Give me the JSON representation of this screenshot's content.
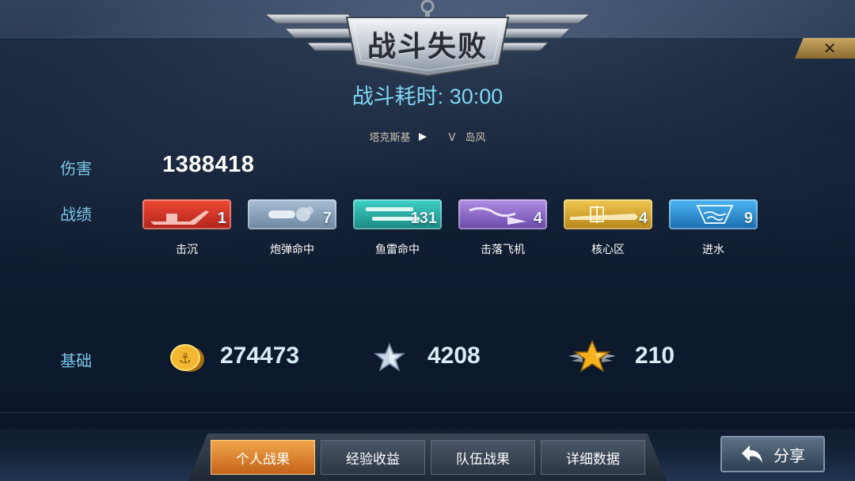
{
  "header": {
    "title": "战斗失败",
    "close_symbol": "✕"
  },
  "battle": {
    "duration_label": "战斗耗时:",
    "duration_value": "30:00",
    "player_ship": "塔克斯基",
    "vs": "V",
    "enemy_ship": "岛风"
  },
  "damage": {
    "label": "伤害",
    "value": "1388418"
  },
  "record": {
    "label": "战绩",
    "medals": [
      {
        "name": "击沉",
        "count": "1",
        "color": "#d9382a",
        "icon": "sinking-ship-icon"
      },
      {
        "name": "炮弹命中",
        "count": "7",
        "color": "#8aa6c2",
        "icon": "shell-hit-icon"
      },
      {
        "name": "鱼雷命中",
        "count": "131",
        "color": "#29b8b0",
        "icon": "torpedo-icon"
      },
      {
        "name": "击落飞机",
        "count": "4",
        "color": "#9a78d0",
        "icon": "plane-down-icon"
      },
      {
        "name": "核心区",
        "count": "4",
        "color": "#e2b23a",
        "icon": "core-zone-icon"
      },
      {
        "name": "进水",
        "count": "9",
        "color": "#3aa2e6",
        "icon": "flooding-icon"
      }
    ]
  },
  "base": {
    "label": "基础",
    "coins": {
      "value": "274473",
      "icon": "gold-anchor-coin-icon"
    },
    "exp": {
      "value": "4208",
      "icon": "silver-star-icon"
    },
    "rank": {
      "value": "210",
      "icon": "winged-gold-star-icon"
    }
  },
  "tabs": [
    {
      "label": "个人战果",
      "active": true
    },
    {
      "label": "经验收益",
      "active": false
    },
    {
      "label": "队伍战果",
      "active": false
    },
    {
      "label": "详细数据",
      "active": false
    }
  ],
  "share": {
    "label": "分享",
    "icon": "share-back-arrow-icon"
  }
}
